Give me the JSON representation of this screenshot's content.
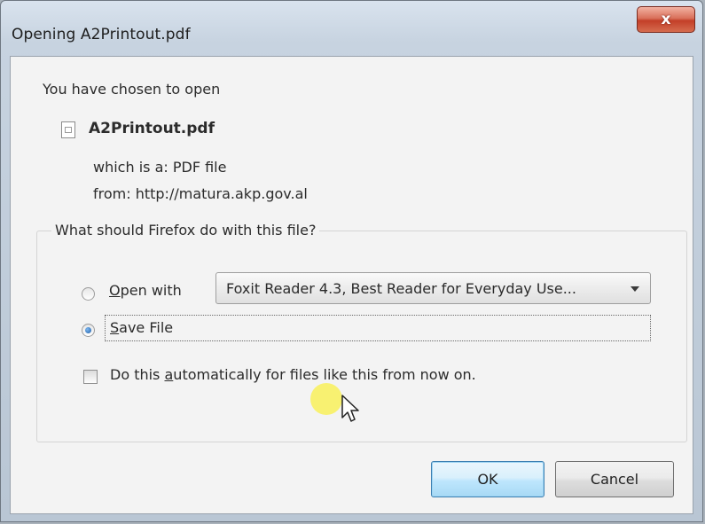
{
  "window": {
    "title": "Opening A2Printout.pdf",
    "close_symbol": "x"
  },
  "info": {
    "intro": "You have chosen to open",
    "file_icon": "document-icon",
    "filename": "A2Printout.pdf",
    "which_is_a": "which is a:  PDF file",
    "from": "from:  http://matura.akp.gov.al"
  },
  "action_group": {
    "legend": "What should Firefox do with this file?",
    "open_with": {
      "accel": "O",
      "rest": "pen with",
      "selected": false,
      "app_select_value": "Foxit Reader 4.3, Best Reader for Everyday Use..."
    },
    "save_file": {
      "accel": "S",
      "rest": "ave File",
      "selected": true
    },
    "auto_checkbox": {
      "before": "Do this ",
      "accel": "a",
      "after": "utomatically for files like this from now on.",
      "checked": false
    }
  },
  "buttons": {
    "ok": "OK",
    "cancel": "Cancel"
  },
  "colors": {
    "title_bar": "#c7d3e0",
    "close_button": "#c33f28",
    "ok_border": "#3c7fb1",
    "cursor_highlight": "#faf046"
  }
}
